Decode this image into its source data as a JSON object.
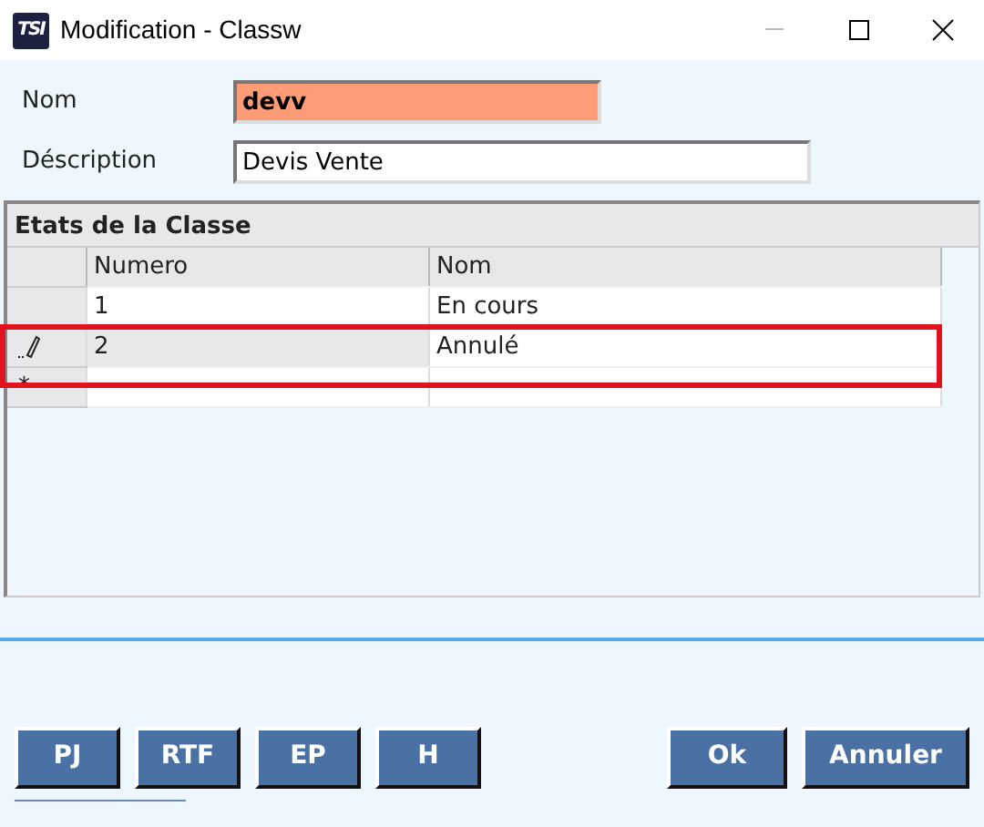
{
  "window": {
    "title": "Modification - Classw",
    "logo": "TSI"
  },
  "fields": [
    {
      "label": "Nom",
      "value": "devv",
      "highlighted": true
    },
    {
      "label": "Déscription",
      "value": "Devis Vente",
      "highlighted": false
    }
  ],
  "grid": {
    "title": "Etats de la Classe",
    "columns": [
      "Numero",
      "Nom"
    ],
    "rows": [
      {
        "kind": "data",
        "cells": [
          "1",
          "En cours"
        ]
      },
      {
        "kind": "editing",
        "cells": [
          "2",
          "Annulé"
        ],
        "annotated": true
      },
      {
        "kind": "new",
        "marker": "*",
        "cells": []
      }
    ]
  },
  "left_buttons": [
    "PJ",
    "RTF",
    "EP",
    "H"
  ],
  "right_buttons": [
    "Ok",
    "Annuler"
  ]
}
